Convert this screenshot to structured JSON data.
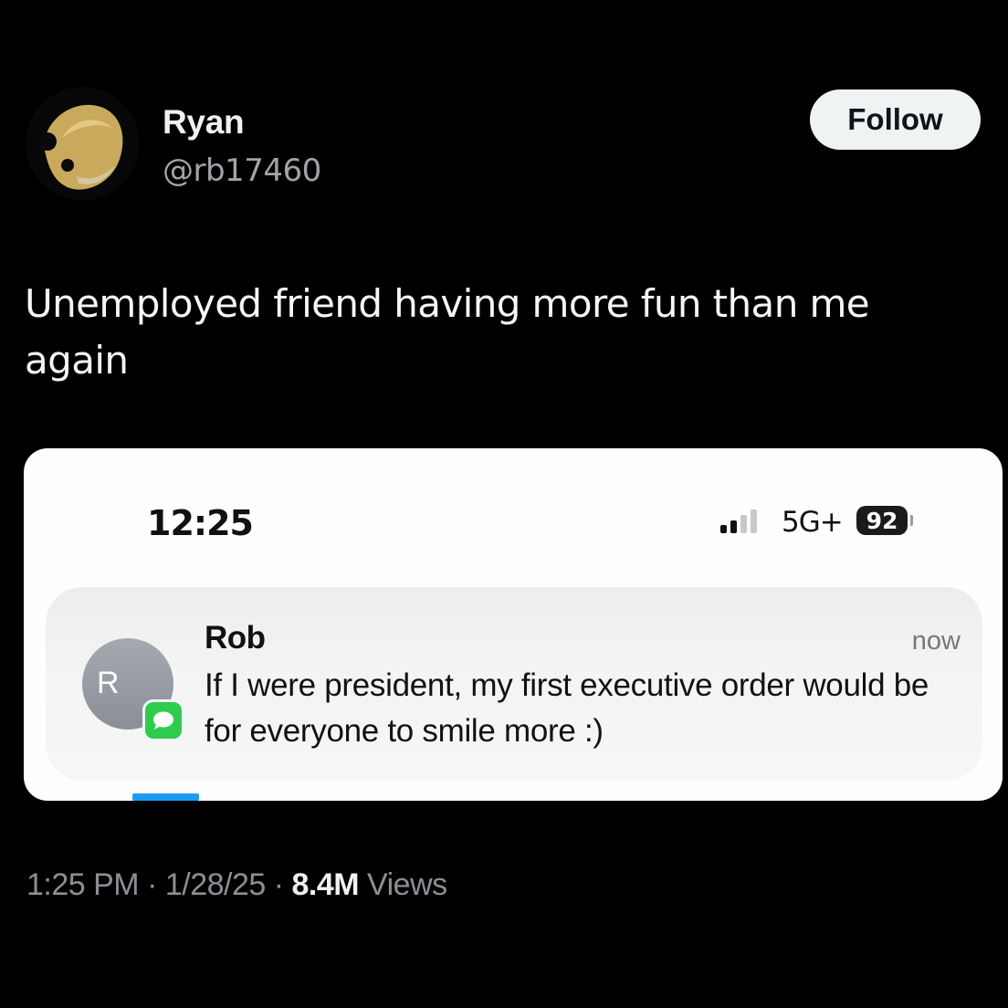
{
  "author": {
    "name": "Ryan",
    "handle": "@rb17460",
    "avatar_icon": "profile-photo"
  },
  "follow_label": "Follow",
  "tweet_text": "Unemployed friend having more fun than me again",
  "screenshot": {
    "status_time": "12:25",
    "network": "5G+",
    "battery": "92",
    "notification": {
      "contact_initial": "R",
      "sender": "Rob",
      "time": "now",
      "body": "If I were president, my first executive order would be for everyone to smile more :)",
      "app_icon": "messages-icon",
      "app_color": "#2fcb4e"
    }
  },
  "meta": {
    "time": "1:25 PM",
    "sep1": " · ",
    "date": "1/28/25",
    "sep2": " · ",
    "views": "8.4M",
    "views_label": " Views"
  },
  "colors": {
    "background": "#000000",
    "accent": "#1d9bf0"
  }
}
